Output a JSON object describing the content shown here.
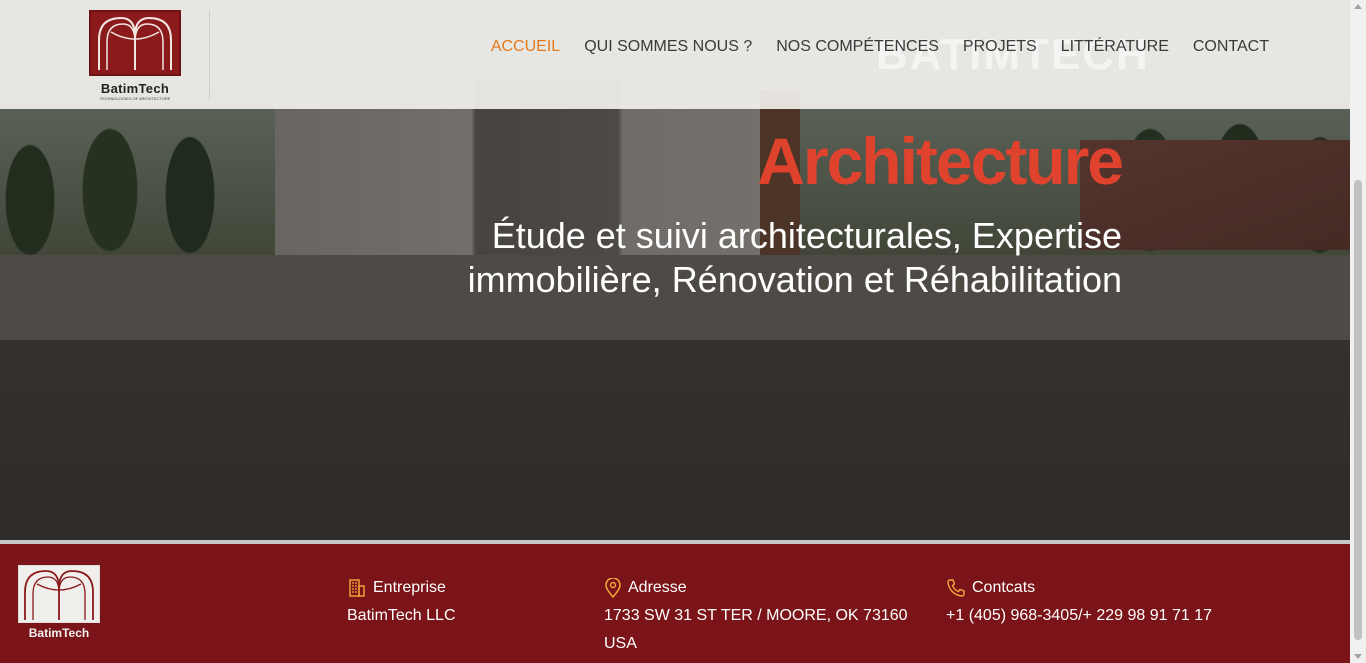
{
  "header": {
    "logo_name": "BatimTech",
    "logo_tagline": "TECHNOLOGIES OF ARCHITECTURE",
    "ghost_brand": "BATIMTECH",
    "nav": [
      {
        "label": "ACCUEIL",
        "active": true
      },
      {
        "label": "QUI SOMMES NOUS ?",
        "active": false
      },
      {
        "label": "NOS COMPÉTENCES",
        "active": false
      },
      {
        "label": "PROJETS",
        "active": false
      },
      {
        "label": "LITTÉRATURE",
        "active": false
      },
      {
        "label": "CONTACT",
        "active": false
      }
    ]
  },
  "hero": {
    "title": "Architecture",
    "subtitle": "Étude et suivi architecturales, Expertise immobilière, Rénovation et Réhabilitation"
  },
  "footer": {
    "logo_name": "BatimTech",
    "company": {
      "icon": "building-icon",
      "heading": "Entreprise",
      "value": "BatimTech LLC"
    },
    "address": {
      "icon": "map-pin-icon",
      "heading": "Adresse",
      "value": "1733 SW 31 ST TER / MOORE, OK 73160 USA"
    },
    "contacts": {
      "icon": "phone-icon",
      "heading": "Contcats",
      "value": "+1 (405) 968-3405/+ 229 98 91 71 17"
    }
  },
  "colors": {
    "accent": "#e47a1e",
    "hero_title": "#e0432d",
    "footer_bg": "#7a1419",
    "logo_red": "#8b1a1d"
  }
}
